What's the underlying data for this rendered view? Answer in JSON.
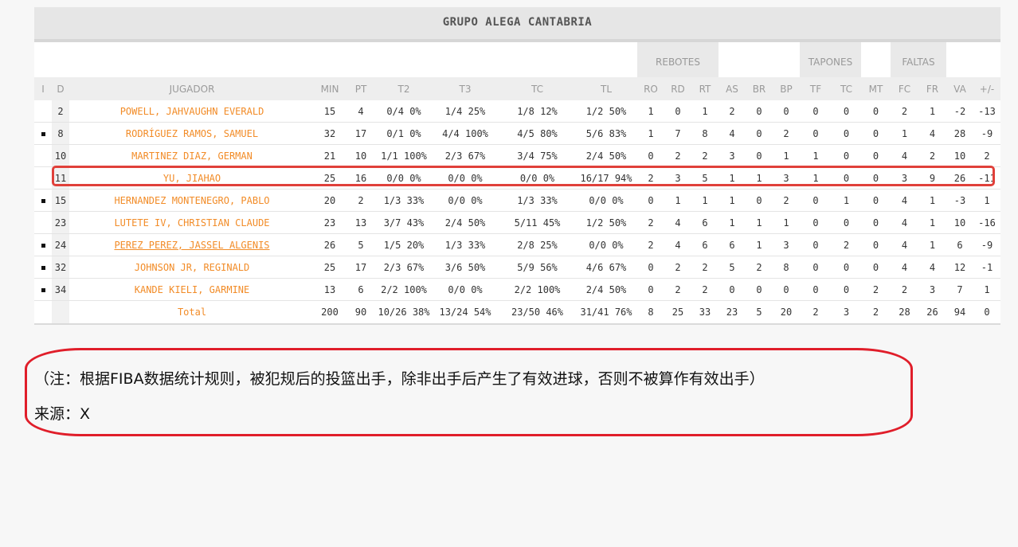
{
  "team_name": "GRUPO ALEGA CANTABRIA",
  "group_headers": {
    "rebotes": "REBOTES",
    "tapones": "TAPONES",
    "faltas": "FALTAS"
  },
  "columns": [
    "I",
    "D",
    "JUGADOR",
    "MIN",
    "PT",
    "T2",
    "T3",
    "TC",
    "TL",
    "RO",
    "RD",
    "RT",
    "AS",
    "BR",
    "BP",
    "TF",
    "TC",
    "MT",
    "FC",
    "FR",
    "VA",
    "+/-"
  ],
  "players": [
    {
      "starter": false,
      "cells": [
        "2",
        "POWELL, JAHVAUGHN EVERALD",
        "15",
        "4",
        "0/4 0%",
        "1/4 25%",
        "1/8 12%",
        "1/2 50%",
        "1",
        "0",
        "1",
        "2",
        "0",
        "0",
        "0",
        "0",
        "0",
        "2",
        "1",
        "-2",
        "-13"
      ]
    },
    {
      "starter": true,
      "cells": [
        "8",
        "RODRÍGUEZ RAMOS, SAMUEL",
        "32",
        "17",
        "0/1 0%",
        "4/4 100%",
        "4/5 80%",
        "5/6 83%",
        "1",
        "7",
        "8",
        "4",
        "0",
        "2",
        "0",
        "0",
        "0",
        "1",
        "4",
        "28",
        "-9"
      ]
    },
    {
      "starter": false,
      "cells": [
        "10",
        "MARTINEZ DIAZ, GERMAN",
        "21",
        "10",
        "1/1 100%",
        "2/3 67%",
        "3/4 75%",
        "2/4 50%",
        "0",
        "2",
        "2",
        "3",
        "0",
        "1",
        "1",
        "0",
        "0",
        "4",
        "2",
        "10",
        "2"
      ]
    },
    {
      "starter": false,
      "cells": [
        "11",
        "YU, JIAHAO",
        "25",
        "16",
        "0/0 0%",
        "0/0 0%",
        "0/0 0%",
        "16/17 94%",
        "2",
        "3",
        "5",
        "1",
        "1",
        "3",
        "1",
        "0",
        "0",
        "3",
        "9",
        "26",
        "-11"
      ]
    },
    {
      "starter": true,
      "cells": [
        "15",
        "HERNANDEZ MONTENEGRO, PABLO",
        "20",
        "2",
        "1/3 33%",
        "0/0 0%",
        "1/3 33%",
        "0/0 0%",
        "0",
        "1",
        "1",
        "1",
        "0",
        "2",
        "0",
        "1",
        "0",
        "4",
        "1",
        "-3",
        "1"
      ]
    },
    {
      "starter": false,
      "cells": [
        "23",
        "LUTETE IV, CHRISTIAN CLAUDE",
        "23",
        "13",
        "3/7 43%",
        "2/4 50%",
        "5/11 45%",
        "1/2 50%",
        "2",
        "4",
        "6",
        "1",
        "1",
        "1",
        "0",
        "0",
        "0",
        "4",
        "1",
        "10",
        "-16"
      ]
    },
    {
      "starter": true,
      "link": true,
      "cells": [
        "24",
        "PEREZ PEREZ, JASSEL ALGENIS",
        "26",
        "5",
        "1/5 20%",
        "1/3 33%",
        "2/8 25%",
        "0/0 0%",
        "2",
        "4",
        "6",
        "6",
        "1",
        "3",
        "0",
        "2",
        "0",
        "4",
        "1",
        "6",
        "-9"
      ]
    },
    {
      "starter": true,
      "cells": [
        "32",
        "JOHNSON JR, REGINALD",
        "25",
        "17",
        "2/3 67%",
        "3/6 50%",
        "5/9 56%",
        "4/6 67%",
        "0",
        "2",
        "2",
        "5",
        "2",
        "8",
        "0",
        "0",
        "0",
        "4",
        "4",
        "12",
        "-1"
      ]
    },
    {
      "starter": true,
      "cells": [
        "34",
        "KANDE KIELI, GARMINE",
        "13",
        "6",
        "2/2 100%",
        "0/0 0%",
        "2/2 100%",
        "2/4 50%",
        "0",
        "2",
        "2",
        "0",
        "0",
        "0",
        "0",
        "0",
        "2",
        "2",
        "3",
        "7",
        "1"
      ]
    }
  ],
  "total": [
    "Total",
    "200",
    "90",
    "10/26 38%",
    "13/24 54%",
    "23/50 46%",
    "31/41 76%",
    "8",
    "25",
    "33",
    "23",
    "5",
    "20",
    "2",
    "3",
    "2",
    "28",
    "26",
    "94",
    "0"
  ],
  "highlighted_player": "YU, JIAHAO",
  "note": {
    "line1": "（注：根据FIBA数据统计规则，被犯规后的投篮出手，除非出手后产生了有效进球，否则不被算作有效出手）",
    "line2": "来源：X"
  },
  "colors": {
    "player_name": "#f28c28",
    "highlight_border": "#e0403a",
    "note_border": "#e01e2a",
    "header_bg": "#eeeeee"
  }
}
